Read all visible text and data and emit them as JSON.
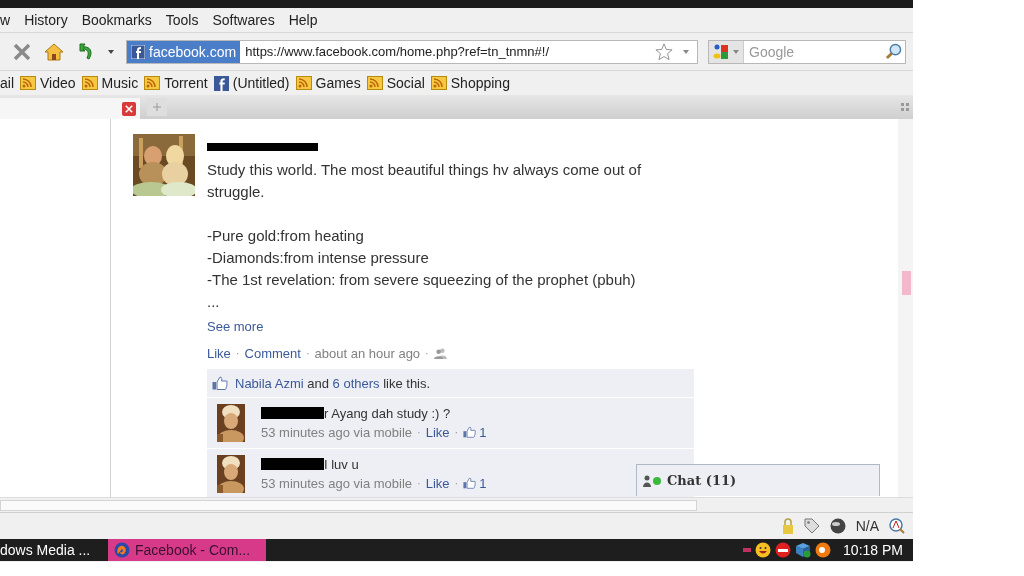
{
  "menu": [
    "w",
    "History",
    "Bookmarks",
    "Tools",
    "Softwares",
    "Help"
  ],
  "address": {
    "identity": "facebook.com",
    "url": "https://www.facebook.com/home.php?ref=tn_tnmn#!/"
  },
  "search": {
    "placeholder": "Google"
  },
  "bookmarks": [
    {
      "label": "ail",
      "kind": "plain"
    },
    {
      "label": "Video",
      "kind": "feed"
    },
    {
      "label": "Music",
      "kind": "feed"
    },
    {
      "label": "Torrent",
      "kind": "feed"
    },
    {
      "label": "(Untitled)",
      "kind": "facebook"
    },
    {
      "label": "Games",
      "kind": "feed"
    },
    {
      "label": "Social",
      "kind": "feed"
    },
    {
      "label": "Shopping",
      "kind": "feed"
    }
  ],
  "post": {
    "paragraphs": [
      [
        "Study this world. The most beautiful things hv always come out of struggle."
      ],
      [
        "-Pure gold:from heating",
        "-Diamonds:from intense pressure",
        "-The 1st revelation: from severe squeezing of the prophet (pbuh)",
        "..."
      ]
    ],
    "separator": "·",
    "see_more": "See more",
    "actions": [
      "Like",
      "Comment"
    ],
    "time": "about an hour ago",
    "likes": {
      "liker": "Nabila Azmi",
      "joiner": "and",
      "others": "6 others",
      "tail": "like this."
    },
    "comments": [
      {
        "text": "r Ayang dah study :) ?",
        "time": "53 minutes ago via mobile",
        "like": "Like",
        "count": "1"
      },
      {
        "text": "I luv u",
        "time": "53 minutes ago via mobile",
        "like": "Like",
        "count": "1"
      }
    ]
  },
  "chat": {
    "label": "Chat (11)"
  },
  "status": {
    "reading": "N/A"
  },
  "taskbar": {
    "items": [
      {
        "label": "dows Media ...",
        "selected": false
      },
      {
        "label": "Facebook - Com...",
        "selected": true
      }
    ],
    "clock": "10:18 PM"
  }
}
